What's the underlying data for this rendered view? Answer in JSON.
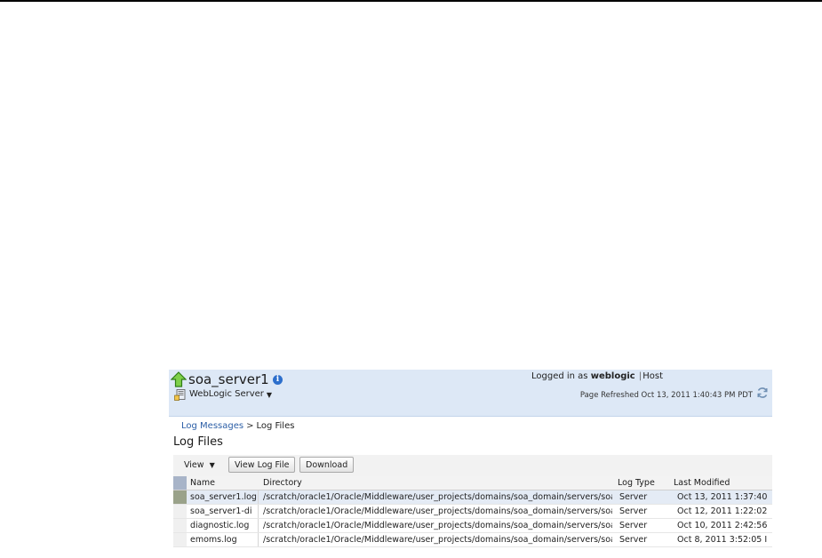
{
  "header": {
    "server_name": "soa_server1",
    "info_glyph": "i",
    "logged_in_prefix": "Logged in as",
    "user": "weblogic",
    "separator": "|",
    "host_label": "Host",
    "target_menu_label": "WebLogic Server",
    "page_refreshed": "Page Refreshed Oct 13, 2011 1:40:43 PM PDT",
    "icons": {
      "status": "up-arrow-icon",
      "info": "info-icon",
      "target": "weblogic-server-icon",
      "refresh": "refresh-icon"
    }
  },
  "breadcrumb": {
    "link": "Log Messages",
    "separator": ">",
    "current": "Log Files"
  },
  "page_title": "Log Files",
  "toolbar": {
    "view_label": "View",
    "view_log_file_label": "View Log File",
    "download_label": "Download"
  },
  "table": {
    "columns": [
      "Name",
      "Directory",
      "Log Type",
      "Last Modified"
    ],
    "rows": [
      {
        "name": "soa_server1.log",
        "directory": "/scratch/oracle1/Oracle/Middleware/user_projects/domains/soa_domain/servers/soa",
        "log_type": "Server",
        "last_modified": "Oct 13, 2011 1:37:40",
        "selected": true
      },
      {
        "name": "soa_server1-di",
        "directory": "/scratch/oracle1/Oracle/Middleware/user_projects/domains/soa_domain/servers/soa",
        "log_type": "Server",
        "last_modified": "Oct 12, 2011 1:22:02",
        "selected": false
      },
      {
        "name": "diagnostic.log",
        "directory": "/scratch/oracle1/Oracle/Middleware/user_projects/domains/soa_domain/servers/soa",
        "log_type": "Server",
        "last_modified": "Oct 10, 2011 2:42:56",
        "selected": false
      },
      {
        "name": "emoms.log",
        "directory": "/scratch/oracle1/Oracle/Middleware/user_projects/domains/soa_domain/servers/soa",
        "log_type": "Server",
        "last_modified": "Oct 8, 2011 3:52:05 I",
        "selected": false
      }
    ]
  },
  "colors": {
    "header_bg": "#dde8f6",
    "link": "#2b5ea6",
    "status_up": "#3a9a1e",
    "selected_row": "#e4ebf5"
  }
}
